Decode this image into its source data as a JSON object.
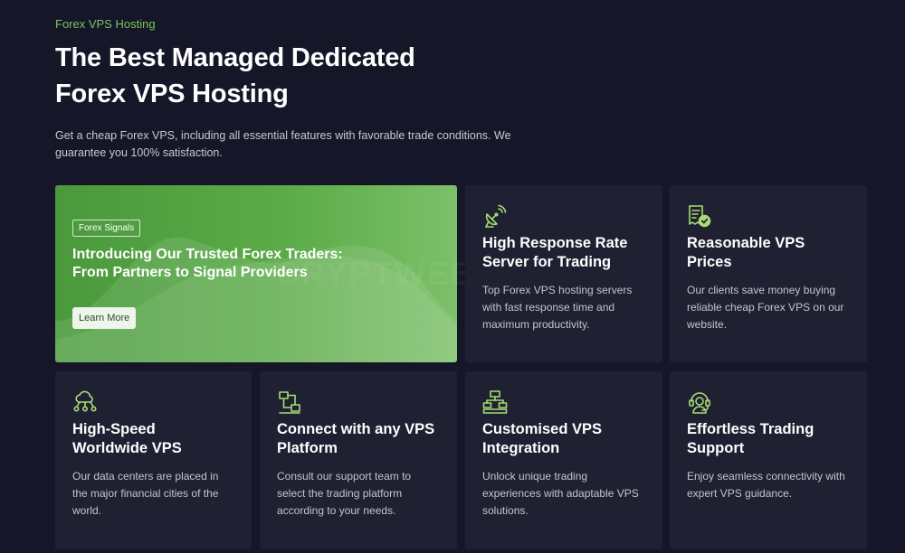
{
  "header": {
    "eyebrow": "Forex VPS Hosting",
    "title": "The Best Managed Dedicated Forex VPS Hosting",
    "subtitle": "Get a cheap Forex VPS, including all essential features with favorable trade conditions. We guarantee you 100% satisfaction."
  },
  "promo": {
    "badge": "Forex Signals",
    "title": "Introducing Our Trusted Forex Traders: From Partners to Signal Providers",
    "button_label": "Learn More"
  },
  "watermark": "CRYPTWEBB.COM",
  "colors": {
    "accent": "#7cc45d",
    "background": "#151728",
    "card": "#1f2132",
    "promo_green": "#5aaa47"
  },
  "features": [
    {
      "icon": "satellite-dish-icon",
      "title": "High Response Rate Server for Trading",
      "description": "Top Forex VPS hosting servers with fast response time and maximum productivity."
    },
    {
      "icon": "receipt-check-icon",
      "title": "Reasonable VPS Prices",
      "description": "Our clients save money buying reliable cheap Forex VPS on our website."
    },
    {
      "icon": "cloud-network-icon",
      "title": "High-Speed Worldwide VPS",
      "description": "Our data centers are placed in the major financial cities of the world."
    },
    {
      "icon": "connect-platform-icon",
      "title": "Connect with any VPS Platform",
      "description": "Consult our support team to select the trading platform according to your needs."
    },
    {
      "icon": "hierarchy-icon",
      "title": "Customised VPS Integration",
      "description": "Unlock unique trading experiences with adaptable VPS solutions."
    },
    {
      "icon": "support-agent-icon",
      "title": "Effortless Trading Support",
      "description": "Enjoy seamless connectivity with expert VPS guidance."
    }
  ]
}
